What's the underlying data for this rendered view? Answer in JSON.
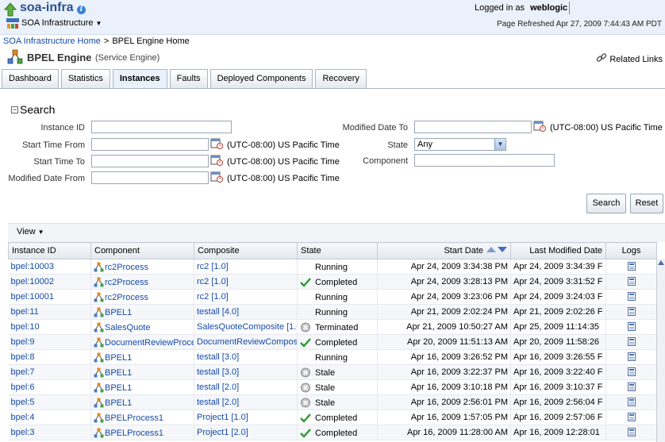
{
  "header": {
    "target_name": "soa-infra",
    "menu_label": "SOA Infrastructure",
    "logged_in_label": "Logged in as",
    "user": "weblogic",
    "refreshed": "Page Refreshed Apr 27, 2009 7:44:43 AM PDT"
  },
  "breadcrumb": {
    "home": "SOA Infrastructure Home",
    "separator": ">",
    "current": "BPEL Engine Home"
  },
  "page": {
    "title": "BPEL Engine",
    "subtitle": "(Service Engine)",
    "related_links": "Related Links"
  },
  "tabs": [
    {
      "label": "Dashboard",
      "active": false
    },
    {
      "label": "Statistics",
      "active": false
    },
    {
      "label": "Instances",
      "active": true
    },
    {
      "label": "Faults",
      "active": false
    },
    {
      "label": "Deployed Components",
      "active": false
    },
    {
      "label": "Recovery",
      "active": false
    }
  ],
  "search": {
    "heading": "Search",
    "instance_id_label": "Instance ID",
    "instance_id_value": "",
    "start_from_label": "Start Time From",
    "start_to_label": "Start Time To",
    "modified_from_label": "Modified Date From",
    "modified_to_label": "Modified Date To",
    "state_label": "State",
    "state_value": "Any",
    "component_label": "Component",
    "component_value": "",
    "timezone": "(UTC-08:00) US Pacific Time",
    "search_button": "Search",
    "reset_button": "Reset"
  },
  "view_menu": "View",
  "table": {
    "columns": [
      "Instance ID",
      "Component",
      "Composite",
      "State",
      "Start Date",
      "Last Modified Date",
      "Logs"
    ],
    "rows": [
      {
        "id": "bpel:10003",
        "component": "rc2Process",
        "composite": "rc2 [1.0]",
        "state": "Running",
        "state_icon": "none",
        "start": "Apr 24, 2009 3:34:38 PM",
        "modified": "Apr 24, 2009 3:34:39 F"
      },
      {
        "id": "bpel:10002",
        "component": "rc2Process",
        "composite": "rc2 [1.0]",
        "state": "Completed",
        "state_icon": "check",
        "start": "Apr 24, 2009 3:28:13 PM",
        "modified": "Apr 24, 2009 3:31:52 F"
      },
      {
        "id": "bpel:10001",
        "component": "rc2Process",
        "composite": "rc2 [1.0]",
        "state": "Running",
        "state_icon": "none",
        "start": "Apr 24, 2009 3:23:06 PM",
        "modified": "Apr 24, 2009 3:24:03 F"
      },
      {
        "id": "bpel:11",
        "component": "BPEL1",
        "composite": "testall [4.0]",
        "state": "Running",
        "state_icon": "none",
        "start": "Apr 21, 2009 2:02:24 PM",
        "modified": "Apr 21, 2009 2:02:26 F"
      },
      {
        "id": "bpel:10",
        "component": "SalesQuote",
        "composite": "SalesQuoteComposite [1.0",
        "state": "Terminated",
        "state_icon": "x-circle",
        "start": "Apr 21, 2009 10:50:27 AM",
        "modified": "Apr 25, 2009 11:14:35"
      },
      {
        "id": "bpel:9",
        "component": "DocumentReviewProces",
        "composite": "DocumentReviewComposi",
        "state": "Completed",
        "state_icon": "check",
        "start": "Apr 20, 2009 11:51:13 AM",
        "modified": "Apr 20, 2009 11:58:26"
      },
      {
        "id": "bpel:8",
        "component": "BPEL1",
        "composite": "testall [3.0]",
        "state": "Running",
        "state_icon": "none",
        "start": "Apr 16, 2009 3:26:52 PM",
        "modified": "Apr 16, 2009 3:26:55 F"
      },
      {
        "id": "bpel:7",
        "component": "BPEL1",
        "composite": "testall [3.0]",
        "state": "Stale",
        "state_icon": "x-circle",
        "start": "Apr 16, 2009 3:22:37 PM",
        "modified": "Apr 16, 2009 3:22:40 F"
      },
      {
        "id": "bpel:6",
        "component": "BPEL1",
        "composite": "testall [2.0]",
        "state": "Stale",
        "state_icon": "x-circle",
        "start": "Apr 16, 2009 3:10:18 PM",
        "modified": "Apr 16, 2009 3:10:37 F"
      },
      {
        "id": "bpel:5",
        "component": "BPEL1",
        "composite": "testall [2.0]",
        "state": "Stale",
        "state_icon": "x-circle",
        "start": "Apr 16, 2009 2:56:01 PM",
        "modified": "Apr 16, 2009 2:56:04 F"
      },
      {
        "id": "bpel:4",
        "component": "BPELProcess1",
        "composite": "Project1 [1.0]",
        "state": "Completed",
        "state_icon": "check",
        "start": "Apr 16, 2009 1:57:05 PM",
        "modified": "Apr 16, 2009 2:57:06 F"
      },
      {
        "id": "bpel:3",
        "component": "BPELProcess1",
        "composite": "Project1 [2.0]",
        "state": "Completed",
        "state_icon": "check",
        "start": "Apr 16, 2009 11:28:00 AM",
        "modified": "Apr 16, 2009 12:28:01"
      }
    ]
  }
}
